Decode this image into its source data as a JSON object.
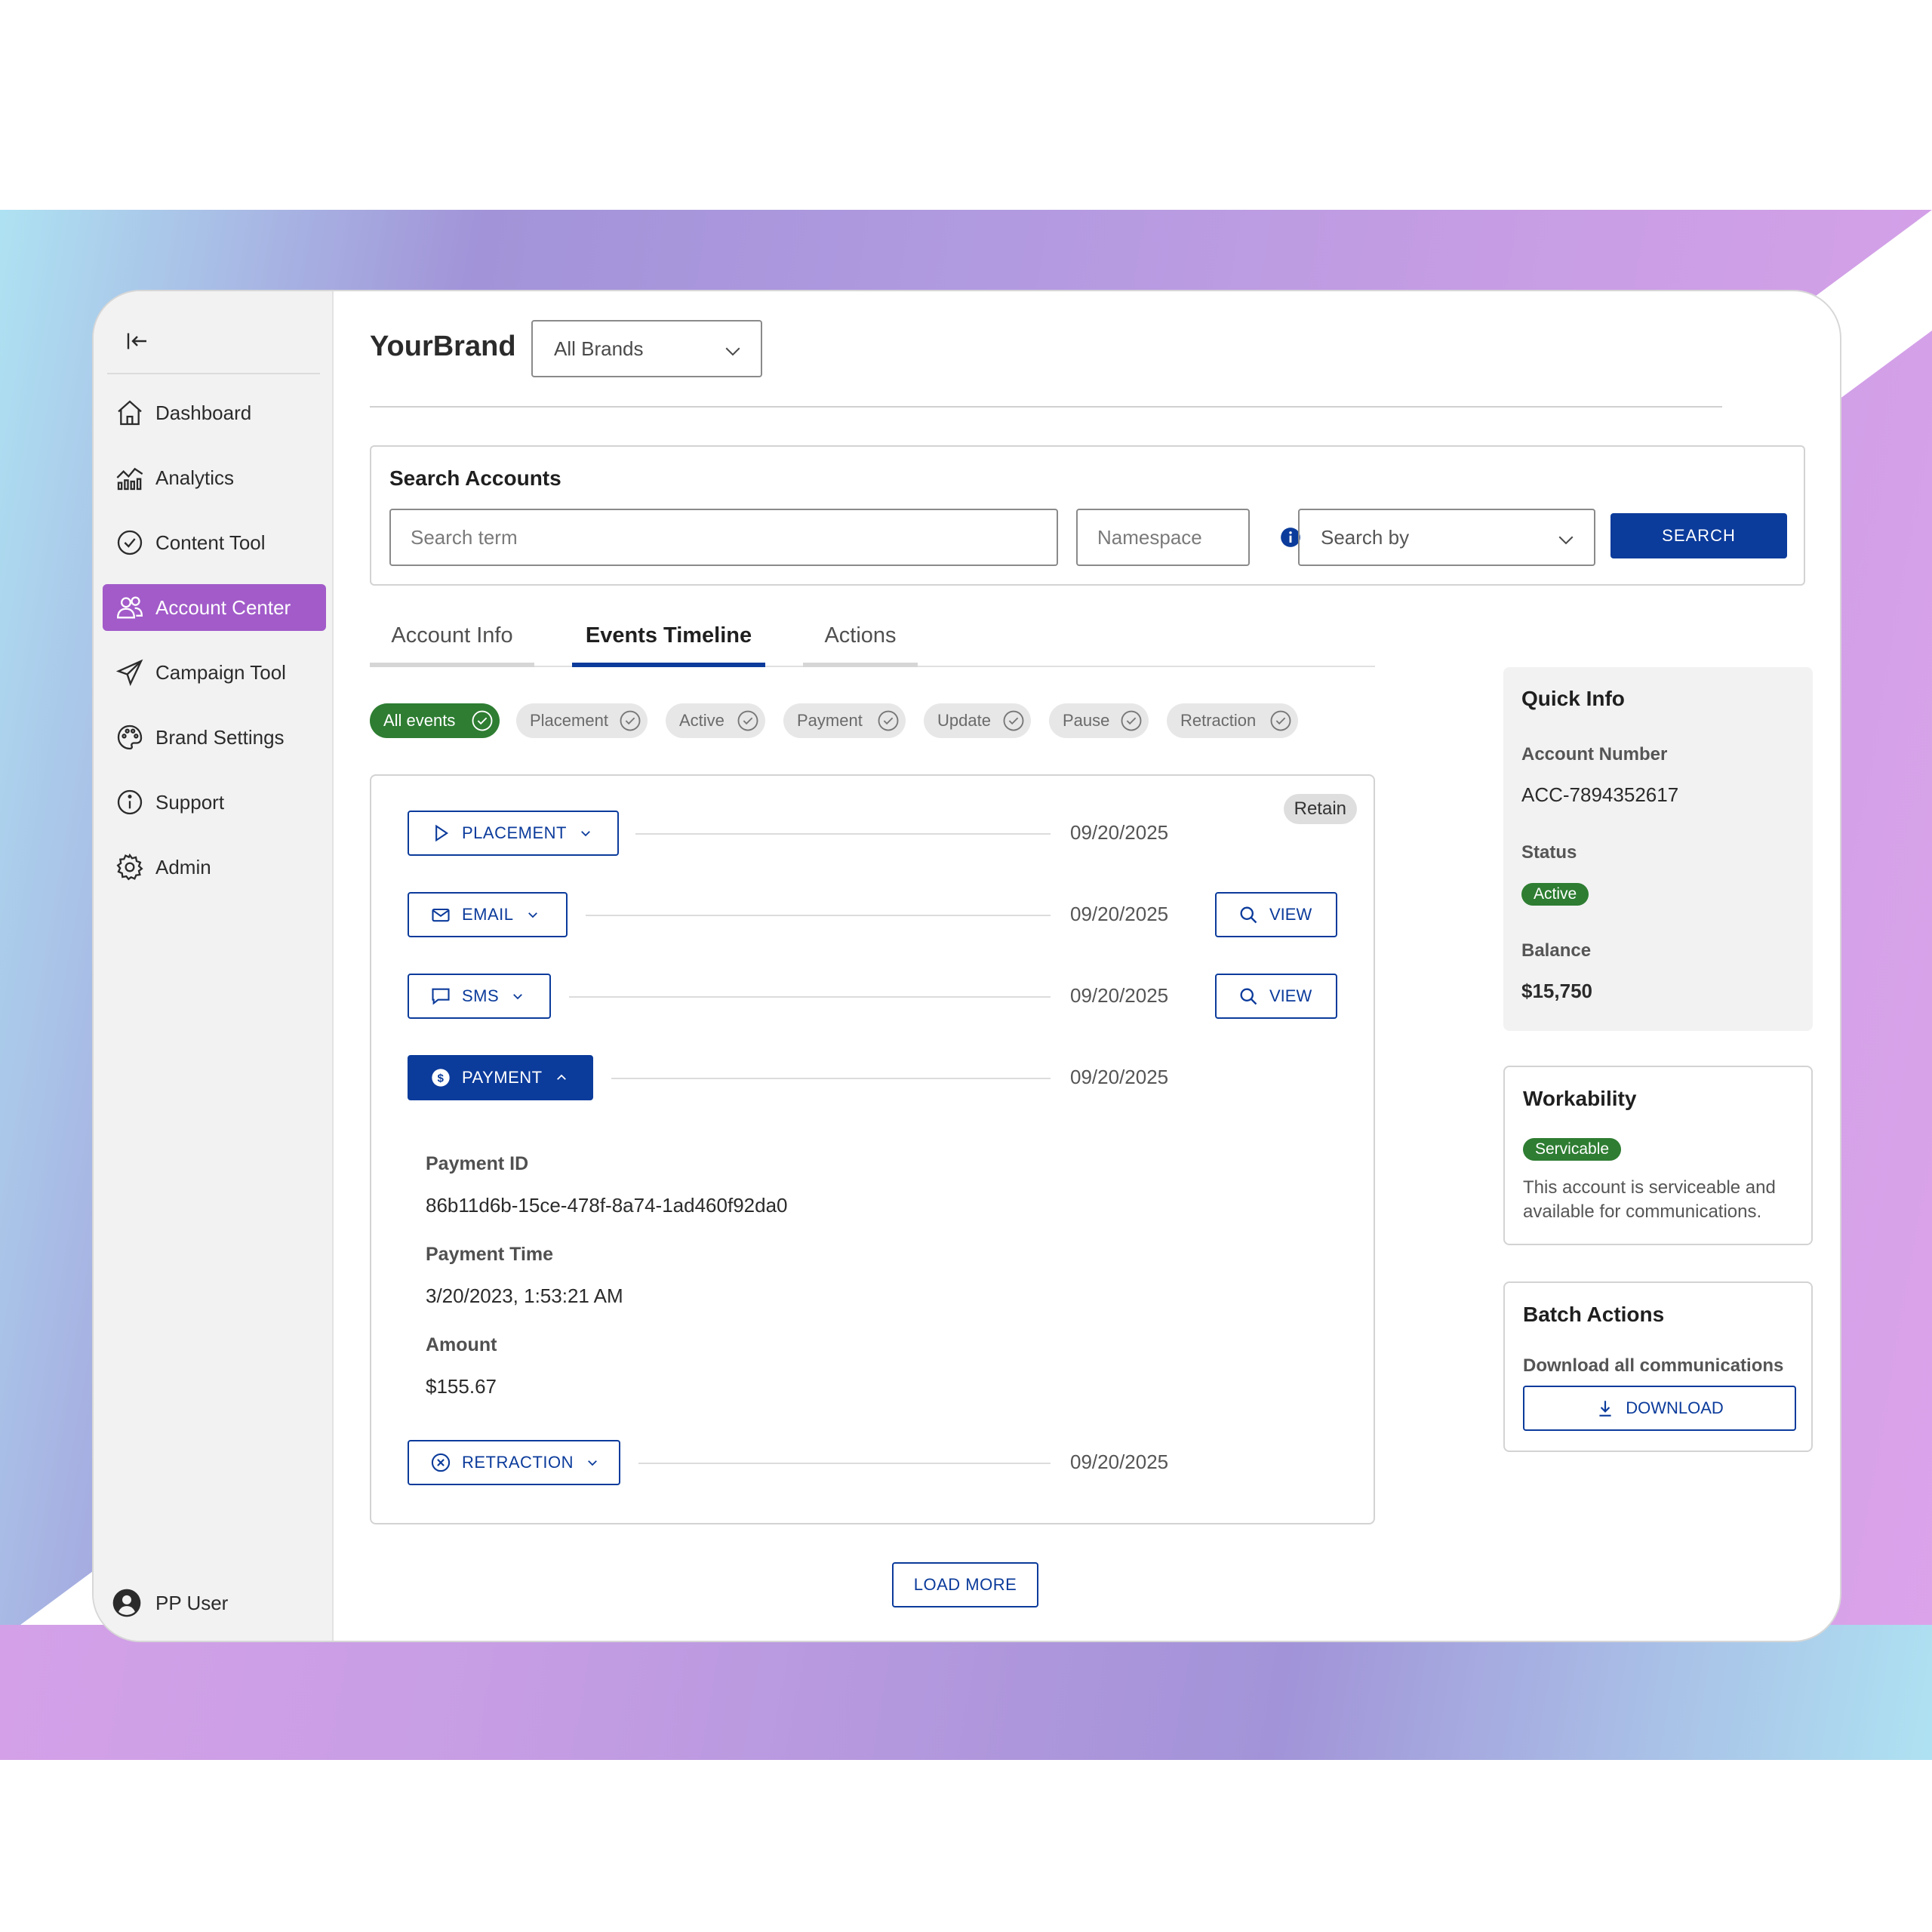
{
  "sidebar": {
    "collapse_icon": "collapse-left-icon",
    "items": [
      {
        "label": "Dashboard",
        "icon": "home-icon"
      },
      {
        "label": "Analytics",
        "icon": "analytics-icon"
      },
      {
        "label": "Content Tool",
        "icon": "check-circle-icon"
      },
      {
        "label": "Account Center",
        "icon": "users-icon",
        "active": true
      },
      {
        "label": "Campaign Tool",
        "icon": "send-icon"
      },
      {
        "label": "Brand Settings",
        "icon": "palette-icon"
      },
      {
        "label": "Support",
        "icon": "info-icon"
      },
      {
        "label": "Admin",
        "icon": "gear-icon"
      }
    ],
    "user": {
      "name": "PP User",
      "icon": "user-avatar-icon"
    }
  },
  "header": {
    "brand": "YourBrand",
    "brand_select": "All Brands"
  },
  "search": {
    "title": "Search Accounts",
    "term_placeholder": "Search term",
    "namespace_placeholder": "Namespace",
    "search_by": "Search by",
    "button": "SEARCH"
  },
  "tabs": [
    {
      "label": "Account Info"
    },
    {
      "label": "Events Timeline",
      "active": true
    },
    {
      "label": "Actions"
    }
  ],
  "filters": [
    {
      "label": "All events",
      "on": true
    },
    {
      "label": "Placement"
    },
    {
      "label": "Active"
    },
    {
      "label": "Payment"
    },
    {
      "label": "Update"
    },
    {
      "label": "Pause"
    },
    {
      "label": "Retraction"
    }
  ],
  "timeline": {
    "tag": "Retain",
    "events": [
      {
        "label": "PLACEMENT",
        "date": "09/20/2025",
        "icon": "play-icon"
      },
      {
        "label": "EMAIL",
        "date": "09/20/2025",
        "icon": "mail-icon",
        "view": "VIEW"
      },
      {
        "label": "SMS",
        "date": "09/20/2025",
        "icon": "message-icon",
        "view": "VIEW"
      },
      {
        "label": "PAYMENT",
        "date": "09/20/2025",
        "icon": "dollar-circle-icon",
        "expanded": true
      },
      {
        "label": "RETRACTION",
        "date": "09/20/2025",
        "icon": "x-circle-icon"
      }
    ],
    "payment_details": {
      "id_label": "Payment ID",
      "id_value": "86b11d6b-15ce-478f-8a74-1ad460f92da0",
      "time_label": "Payment Time",
      "time_value": "3/20/2023, 1:53:21 AM",
      "amount_label": "Amount",
      "amount_value": "$155.67"
    },
    "load_more": "LOAD MORE"
  },
  "quick_info": {
    "title": "Quick Info",
    "account_label": "Account Number",
    "account_value": "ACC-7894352617",
    "status_label": "Status",
    "status_value": "Active",
    "balance_label": "Balance",
    "balance_value": "$15,750"
  },
  "workability": {
    "title": "Workability",
    "badge": "Servicable",
    "desc": "This account is serviceable and available for communications."
  },
  "batch": {
    "title": "Batch Actions",
    "label": "Download all communications",
    "button": "DOWNLOAD"
  },
  "colors": {
    "primary": "#0b3b9b",
    "accent": "#a25bc9",
    "success": "#2e7d32"
  }
}
